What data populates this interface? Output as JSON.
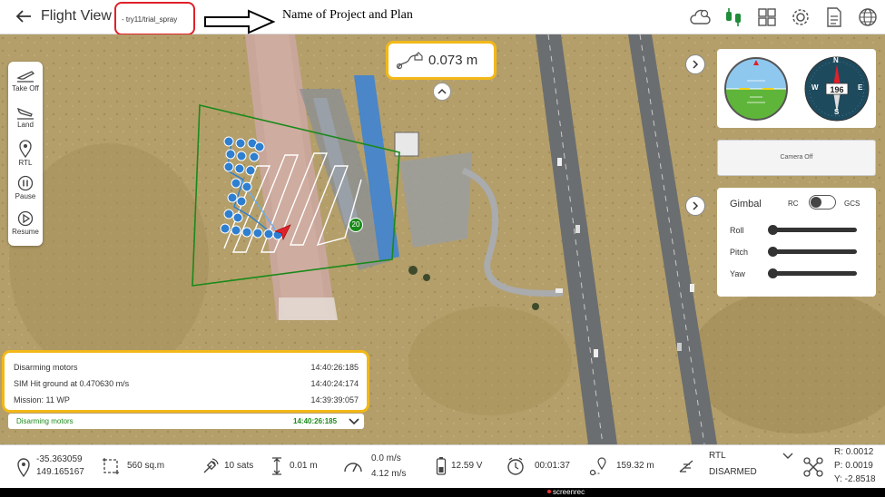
{
  "header": {
    "title": "Flight View",
    "plan_name": "- try11/trial_spray",
    "annotation": "Name of Project and Plan",
    "icons": [
      "weather-cloud-icon",
      "connection-icon",
      "layout-icon",
      "settings-gear-icon",
      "document-icon",
      "globe-icon"
    ]
  },
  "controls": [
    {
      "label": "Take Off",
      "icon": "takeoff-icon"
    },
    {
      "label": "Land",
      "icon": "land-icon"
    },
    {
      "label": "RTL",
      "icon": "rtl-pin-icon"
    },
    {
      "label": "Pause",
      "icon": "pause-icon"
    },
    {
      "label": "Resume",
      "icon": "resume-icon"
    }
  ],
  "map": {
    "altitude_distance": "0.073 m",
    "waypoint_badge": "20"
  },
  "instruments": {
    "compass_heading": "196",
    "compass_labels": {
      "n": "N",
      "s": "S",
      "e": "E",
      "w": "W"
    },
    "camera_status": "Camera Off"
  },
  "gimbal": {
    "title": "Gimbal",
    "rc_label": "RC",
    "gcs_label": "GCS",
    "axes": [
      {
        "label": "Roll",
        "value": 0
      },
      {
        "label": "Pitch",
        "value": 0
      },
      {
        "label": "Yaw",
        "value": 0
      }
    ]
  },
  "log": {
    "entries": [
      {
        "message": "Disarming motors",
        "time": "14:40:26:185"
      },
      {
        "message": "SIM Hit ground at 0.470630 m/s",
        "time": "14:40:24:174"
      },
      {
        "message": "Mission: 11 WP",
        "time": "14:39:39:057"
      }
    ],
    "latest": {
      "message": "Disarming motors",
      "time": "14:40:26:185"
    }
  },
  "status": {
    "lat": "-35.363059",
    "lon": "149.165167",
    "area": "560 sq.m",
    "sats": "10 sats",
    "altitude": "0.01 m",
    "speed_vertical": "0.0 m/s",
    "speed_ground": "4.12 m/s",
    "battery": "12.59 V",
    "flight_time": "00:01:37",
    "home_distance": "159.32 m",
    "mode": "RTL",
    "arm_state": "DISARMED",
    "roll": "R: 0.0012",
    "pitch": "P: 0.0019",
    "yaw": "Y: -2.8518"
  },
  "recorder": {
    "label": "screenrec"
  },
  "colors": {
    "highlight": "#f2b818",
    "plan_box": "#e0202a",
    "geofence": "#1a8a1a",
    "waypoint": "#2f7fd0",
    "status_green": "#1c8a1c"
  }
}
